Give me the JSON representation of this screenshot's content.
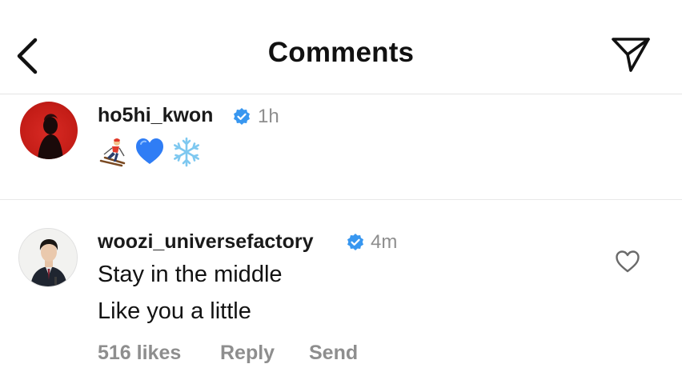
{
  "header": {
    "title": "Comments",
    "back_icon": "chevron-left-icon",
    "share_icon": "paper-plane-icon"
  },
  "caption": {
    "username": "ho5hi_kwon",
    "verified": true,
    "time": "1h",
    "emojis": [
      "skier-icon",
      "blue-heart-icon",
      "snowflake-icon"
    ],
    "avatar_color": "#d0221c"
  },
  "comment": {
    "username": "woozi_universefactory",
    "verified": true,
    "time": "4m",
    "lines": [
      "Stay in the middle",
      "Like you a little"
    ],
    "likes": "516 likes",
    "reply_label": "Reply",
    "send_label": "Send",
    "like_icon": "heart-outline-icon"
  },
  "colors": {
    "verified_badge": "#3897f0",
    "secondary_text": "#8e8e8e",
    "divider": "#e8e8e8"
  }
}
